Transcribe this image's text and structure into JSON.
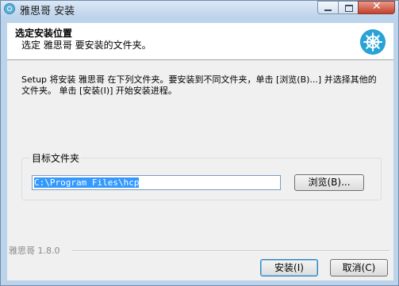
{
  "window": {
    "title": "雅思哥 安装"
  },
  "header": {
    "title": "选定安装位置",
    "subtitle": "选定 雅思哥 要安装的文件夹。"
  },
  "content": {
    "description": "Setup 将安装 雅思哥 在下列文件夹。要安装到不同文件夹，单击 [浏览(B)...] 并选择其他的文件夹。 单击 [安装(I)] 开始安装进程。",
    "group_label": "目标文件夹",
    "path_value": "C:\\Program Files\\hcp",
    "browse_label": "浏览(B)..."
  },
  "footer": {
    "brand": "雅思哥 1.8.0",
    "install_label": "安装(I)",
    "cancel_label": "取消(C)"
  },
  "colors": {
    "accent": "#29a3d6",
    "selection": "#3399ff"
  }
}
